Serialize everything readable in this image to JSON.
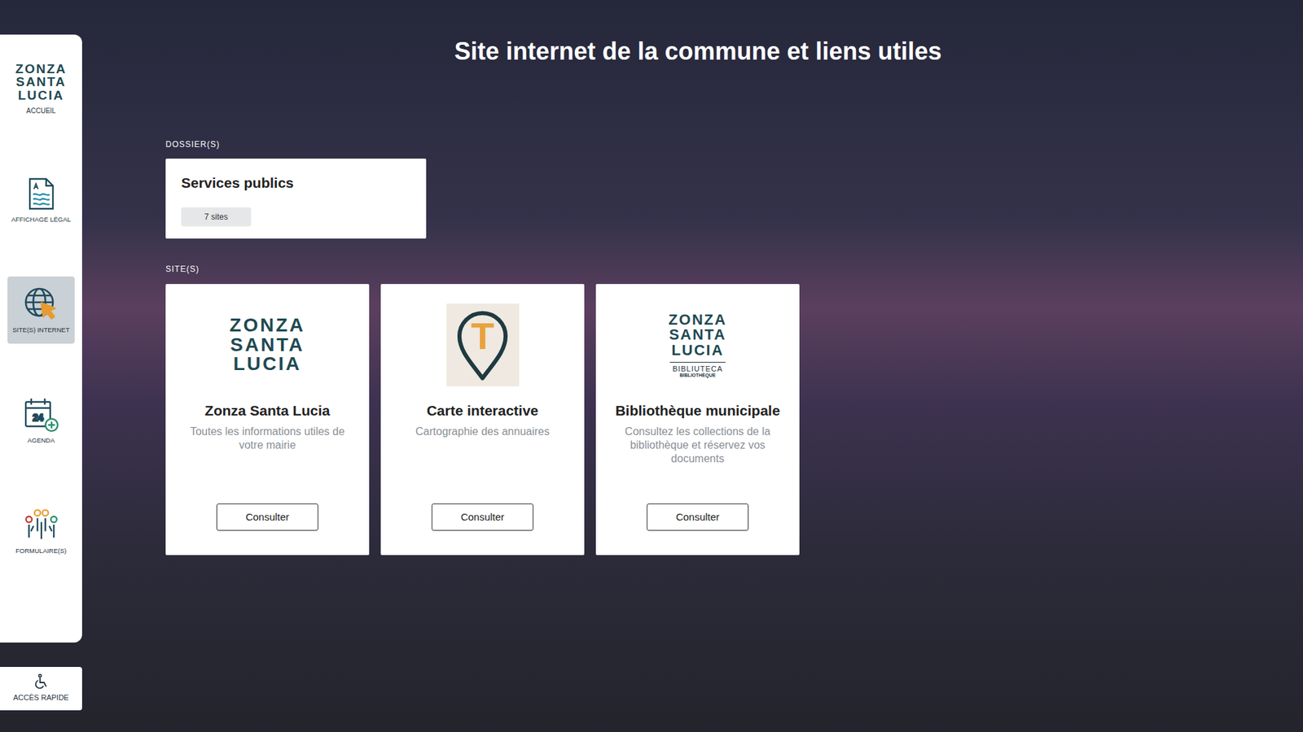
{
  "sidebar": {
    "logo": {
      "lines": [
        "ZONZA",
        "SANTA",
        "LUCIA"
      ],
      "label": "ACCUEIL"
    },
    "items": [
      {
        "label": "AFFICHAGE LÉGAL",
        "selected": false
      },
      {
        "label": "SITE(S) INTERNET",
        "selected": true
      },
      {
        "label": "AGENDA",
        "selected": false,
        "icon_text": "24"
      },
      {
        "label": "FORMULAIRE(S)",
        "selected": false
      }
    ]
  },
  "quick_access": {
    "label": "ACCÈS RAPIDE"
  },
  "title": "Site internet de la commune et liens utiles",
  "folders_label": "DOSSIER(S)",
  "folders": [
    {
      "title": "Services publics",
      "count": "7 sites"
    }
  ],
  "sites_label": "SITE(S)",
  "sites": [
    {
      "kind": "wordmark",
      "logo_lines": [
        "ZONZA",
        "SANTA",
        "LUCIA"
      ],
      "title": "Zonza Santa Lucia",
      "description": "Toutes les informations utiles de votre mairie",
      "button": "Consulter"
    },
    {
      "kind": "pin",
      "logo_letter": "T",
      "title": "Carte interactive",
      "description": "Cartographie des annuaires",
      "button": "Consulter"
    },
    {
      "kind": "wordmark-sub",
      "logo_lines": [
        "ZONZA",
        "SANTA",
        "LUCIA"
      ],
      "logo_sub": [
        "BIBLIUTECA",
        "BIBLIOTHÈQUE"
      ],
      "title": "Bibliothèque municipale",
      "description": "Consultez les collections de la bibliothèque et réservez vos documents",
      "button": "Consulter"
    }
  ]
}
